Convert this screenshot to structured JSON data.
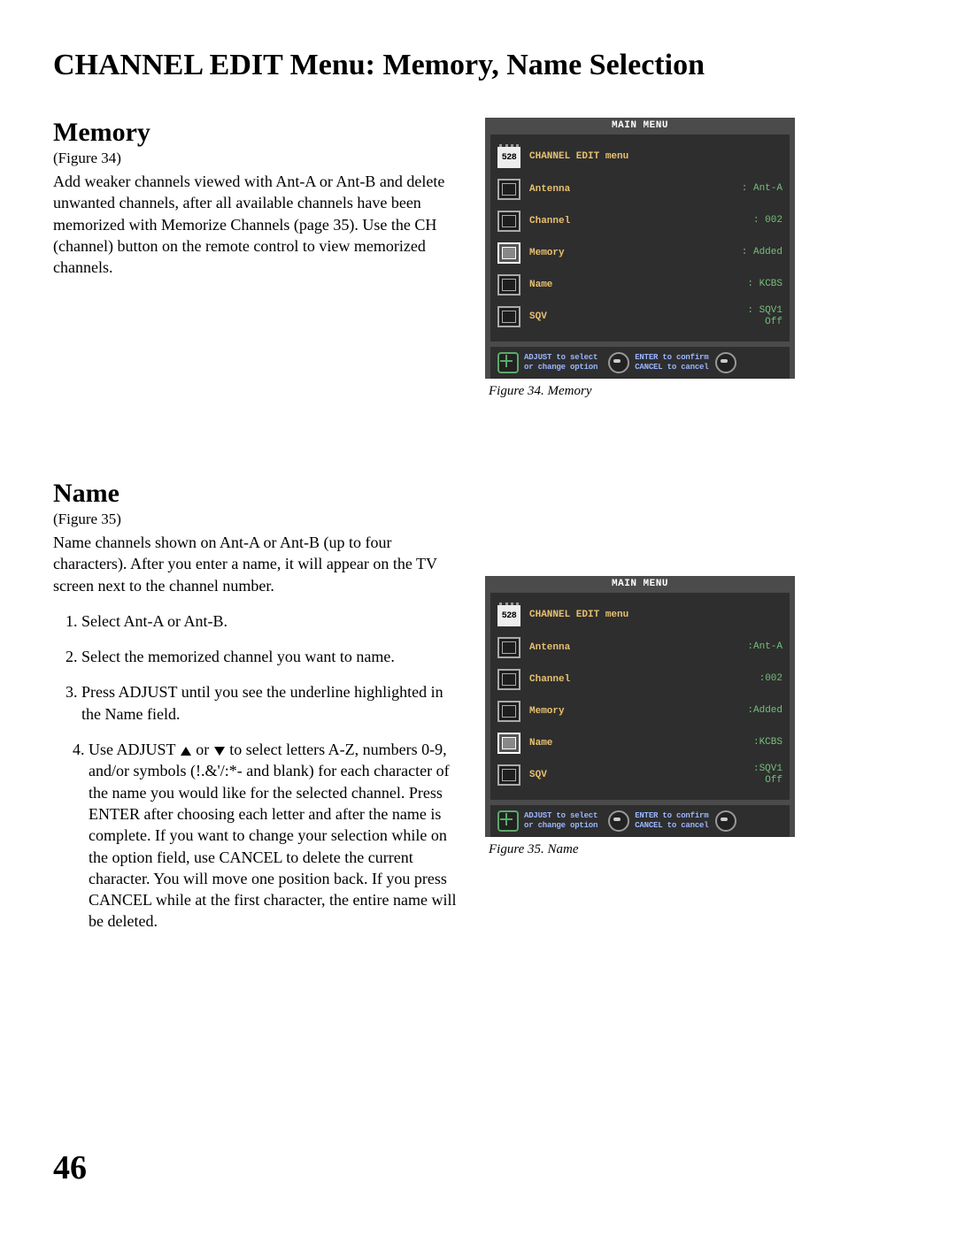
{
  "title": "CHANNEL EDIT Menu: Memory, Name Selection",
  "page_number": "46",
  "memory": {
    "heading": "Memory",
    "figref": "(Figure 34)",
    "body": "Add weaker channels viewed with Ant-A or Ant-B and delete unwanted channels, after all available channels have been memorized with Memorize Channels (page 35).  Use the CH (channel) button on the remote control to view memorized channels."
  },
  "name": {
    "heading": "Name",
    "figref": "(Figure  35)",
    "body": "Name channels shown on Ant-A or Ant-B (up to four characters).  After you enter a name, it will appear on the TV screen next to the channel number.",
    "steps": {
      "s1": "Select Ant-A or Ant-B.",
      "s2": "Select the memorized channel you want to name.",
      "s3": "Press ADJUST until you see the underline highlighted in the Name field.",
      "s4a": "Use ADJUST ",
      "s4b": " or ",
      "s4c": " to select letters A-Z, numbers 0-9, and/or symbols (!.&'/:*- and blank) for each character of the name you would like for the selected channel.  Press ENTER after choosing each letter and after the name is complete. If you want to change your selection while on the option field, use CANCEL to delete the current character. You will move one position back.  If you press CANCEL while at the first character, the entire name will be deleted."
    }
  },
  "figure34_caption": "Figure 34.  Memory",
  "figure35_caption": "Figure  35.  Name",
  "osd_common": {
    "main_title": "MAIN MENU",
    "submenu": "CHANNEL EDIT menu",
    "icon528": "528",
    "footer": {
      "adjust1": "ADJUST to select",
      "adjust2": "or change option",
      "enter": "ENTER to confirm",
      "cancel": "CANCEL to cancel"
    }
  },
  "fig34": {
    "rows": {
      "antenna_label": "Antenna",
      "antenna_value": ": Ant-A",
      "channel_label": "Channel",
      "channel_value": ": 002",
      "memory_label": "Memory",
      "memory_value": ": Added",
      "name_label": "Name",
      "name_value": ": KCBS",
      "sqv_label": "SQV",
      "sqv_value": ": SQV1\n  Off"
    }
  },
  "fig35": {
    "rows": {
      "antenna_label": "Antenna",
      "antenna_value": ":Ant-A",
      "channel_label": "Channel",
      "channel_value": ":002",
      "memory_label": "Memory",
      "memory_value": ":Added",
      "name_label": "Name",
      "name_value": ":KCBS",
      "sqv_label": "SQV",
      "sqv_value": ":SQV1\n Off"
    }
  }
}
